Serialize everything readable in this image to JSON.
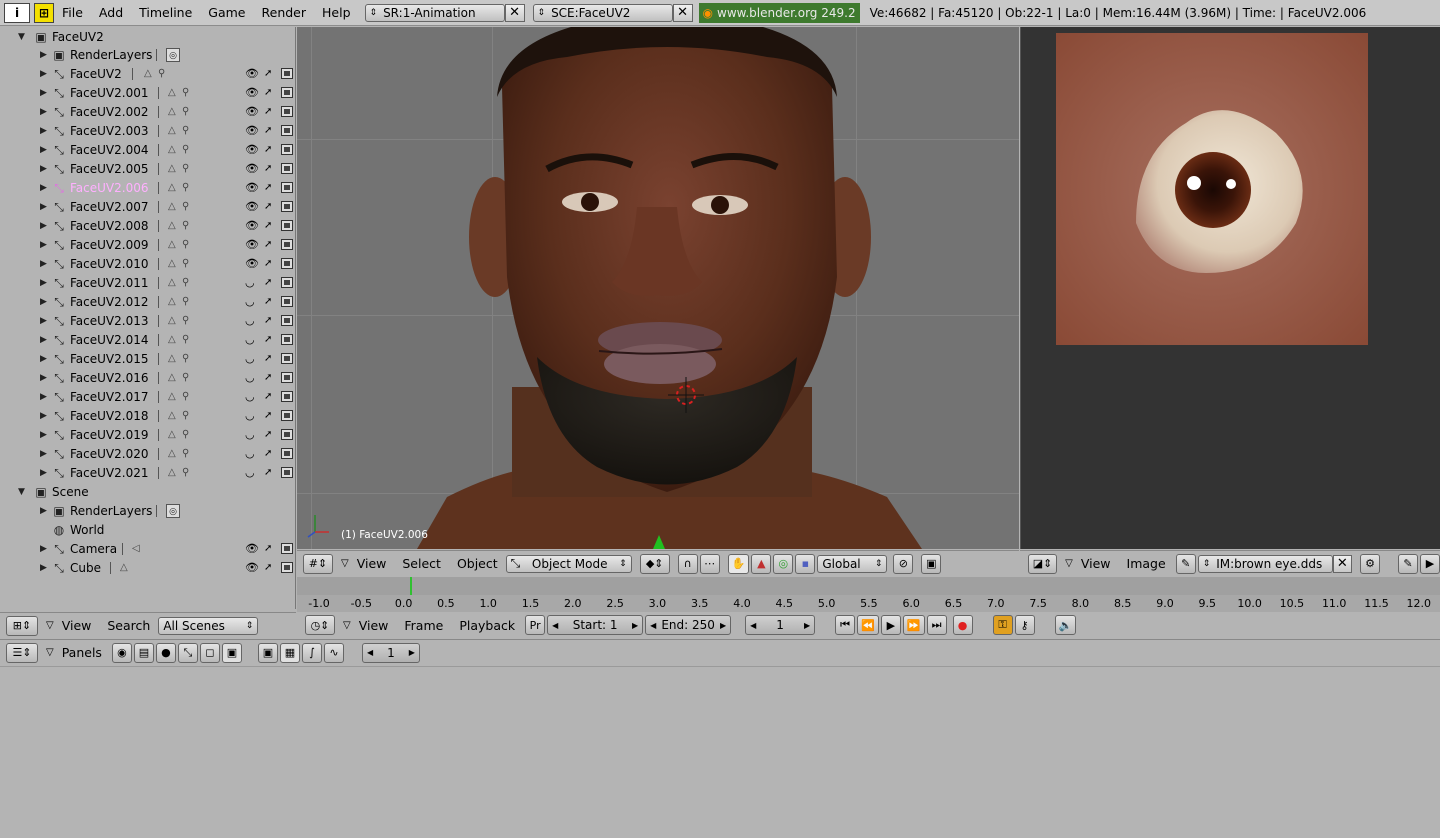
{
  "topbar": {
    "menus": [
      "File",
      "Add",
      "Timeline",
      "Game",
      "Render",
      "Help"
    ],
    "screen": "SR:1-Animation",
    "scene": "SCE:FaceUV2",
    "url": "www.blender.org 249.2",
    "stats": "Ve:46682 | Fa:45120 | Ob:22-1 | La:0  | Mem:16.44M (3.96M)  | Time: | FaceUV2.006"
  },
  "outliner": {
    "scene1": "FaceUV2",
    "renderlayers": "RenderLayers",
    "objects": [
      "FaceUV2",
      "FaceUV2.001",
      "FaceUV2.002",
      "FaceUV2.003",
      "FaceUV2.004",
      "FaceUV2.005",
      "FaceUV2.006",
      "FaceUV2.007",
      "FaceUV2.008",
      "FaceUV2.009",
      "FaceUV2.010",
      "FaceUV2.011",
      "FaceUV2.012",
      "FaceUV2.013",
      "FaceUV2.014",
      "FaceUV2.015",
      "FaceUV2.016",
      "FaceUV2.017",
      "FaceUV2.018",
      "FaceUV2.019",
      "FaceUV2.020",
      "FaceUV2.021"
    ],
    "scene2": "Scene",
    "scene2_renderlayers": "RenderLayers",
    "world": "World",
    "camera": "Camera",
    "cube": "Cube",
    "header": {
      "view": "View",
      "search": "Search",
      "filter": "All Scenes"
    }
  },
  "viewport": {
    "object_label": "(1) FaceUV2.006",
    "header": {
      "view": "View",
      "select": "Select",
      "object": "Object",
      "mode": "Object Mode",
      "orientation": "Global"
    }
  },
  "image_editor": {
    "header": {
      "view": "View",
      "image": "Image",
      "image_name": "IM:brown eye.dds"
    }
  },
  "timeline": {
    "ticks": [
      "-1.0",
      "-0.5",
      "0.0",
      "0.5",
      "1.0",
      "1.5",
      "2.0",
      "2.5",
      "3.0",
      "3.5",
      "4.0",
      "4.5",
      "5.0",
      "5.5",
      "6.0",
      "6.5",
      "7.0",
      "7.5",
      "8.0",
      "8.5",
      "9.0",
      "9.5",
      "10.0",
      "10.5",
      "11.0",
      "11.5",
      "12.0"
    ],
    "header": {
      "view": "View",
      "frame": "Frame",
      "playback": "Playback",
      "pr": "Pr",
      "start": "Start: 1",
      "end": "End: 250",
      "current": "1"
    }
  },
  "buttons": {
    "header": {
      "panels": "Panels",
      "frame": "1"
    }
  },
  "colors": {
    "url_bg": "#3e7a2e",
    "active_object": "#ffb0ff",
    "skin": "#5a2e1c"
  }
}
